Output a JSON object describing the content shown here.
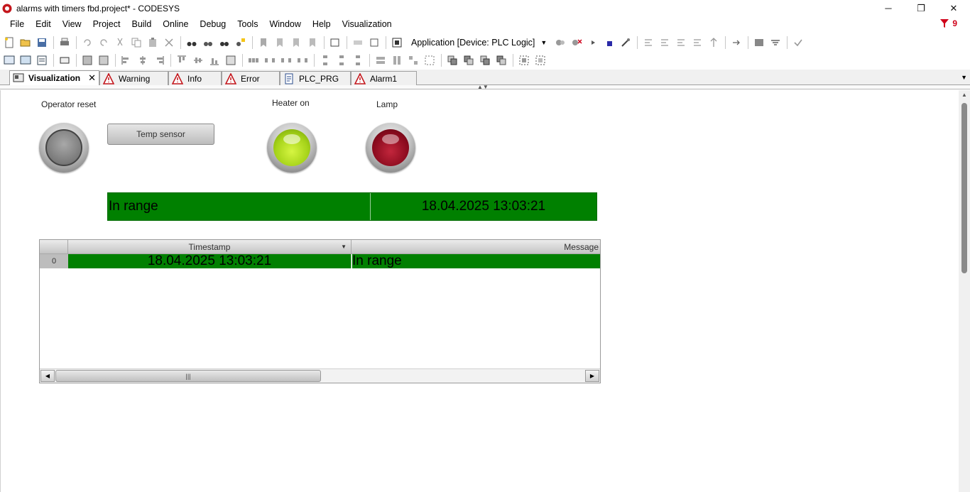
{
  "window": {
    "title": "alarms with timers fbd.project* - CODESYS",
    "minimize": "─",
    "restore": "❐",
    "close": "✕"
  },
  "menu": {
    "items": [
      "File",
      "Edit",
      "View",
      "Project",
      "Build",
      "Online",
      "Debug",
      "Tools",
      "Window",
      "Help",
      "Visualization"
    ],
    "alert_count": "9"
  },
  "toolbar": {
    "device_selector": "Application [Device: PLC Logic]"
  },
  "tabs": [
    {
      "label": "Visualization",
      "icon": "visualization-icon",
      "active": true
    },
    {
      "label": "Warning",
      "icon": "alarm-triangle-icon"
    },
    {
      "label": "Info",
      "icon": "alarm-triangle-icon"
    },
    {
      "label": "Error",
      "icon": "alarm-triangle-icon"
    },
    {
      "label": "PLC_PRG",
      "icon": "program-icon"
    },
    {
      "label": "Alarm1",
      "icon": "alarm-triangle-icon"
    }
  ],
  "visualization": {
    "operator_reset_label": "Operator reset",
    "temp_sensor_button": "Temp sensor",
    "heater_on_label": "Heater on",
    "lamp_label": "Lamp",
    "lamps": {
      "operator_reset": {
        "state": "off",
        "color": "#8f8f8f"
      },
      "heater_on": {
        "state": "on",
        "color": "#9acd1a"
      },
      "lamp": {
        "state": "on",
        "color": "#8b0b1e"
      }
    },
    "status_banner": {
      "message": "In range",
      "timestamp": "18.04.2025 13:03:21",
      "color": "#008000"
    },
    "alarm_table": {
      "columns": [
        "Timestamp",
        "Message"
      ],
      "rows": [
        {
          "index": "0",
          "timestamp": "18.04.2025 13:03:21",
          "message": "In range"
        }
      ]
    }
  }
}
